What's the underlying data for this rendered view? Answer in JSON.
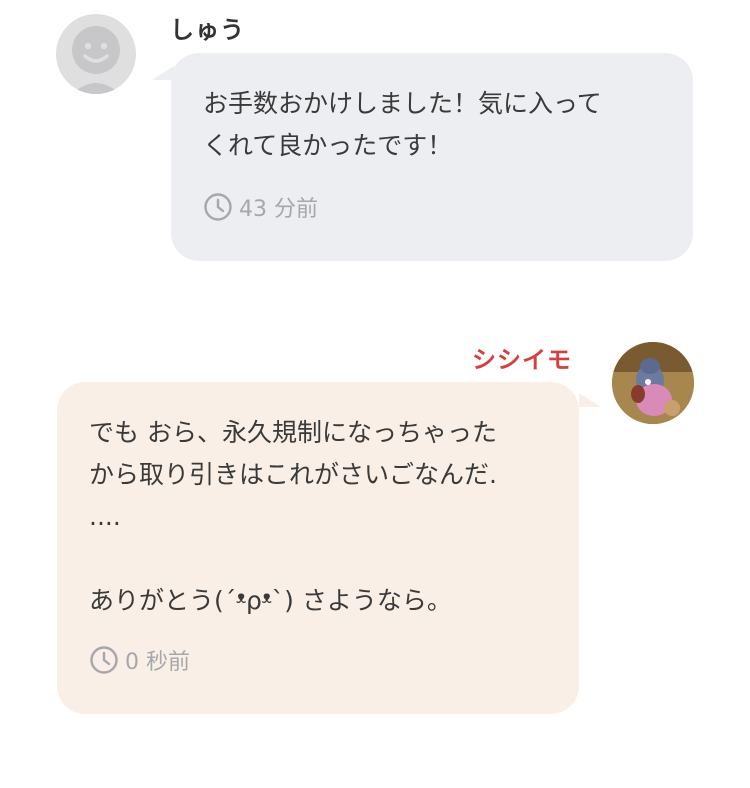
{
  "messages": [
    {
      "sender": "しゅう",
      "text": "お手数おかけしました！気に入って\nくれて良かったです！",
      "time": "43 分前"
    },
    {
      "sender": "シシイモ",
      "text": "でも おら、永久規制になっちゃった\nから取り引きはこれがさいごなんだ.\n....\n\nありがとう(´ᵜρᵜ`) さようなら。",
      "time": "0 秒前"
    }
  ],
  "colors": {
    "incoming_bubble": "#edeef2",
    "outgoing_bubble": "#f9efe6",
    "own_name": "#d24040",
    "timestamp": "#a6a6ab"
  },
  "icons": {
    "default_avatar": "default-avatar-icon",
    "time": "clock-icon"
  }
}
